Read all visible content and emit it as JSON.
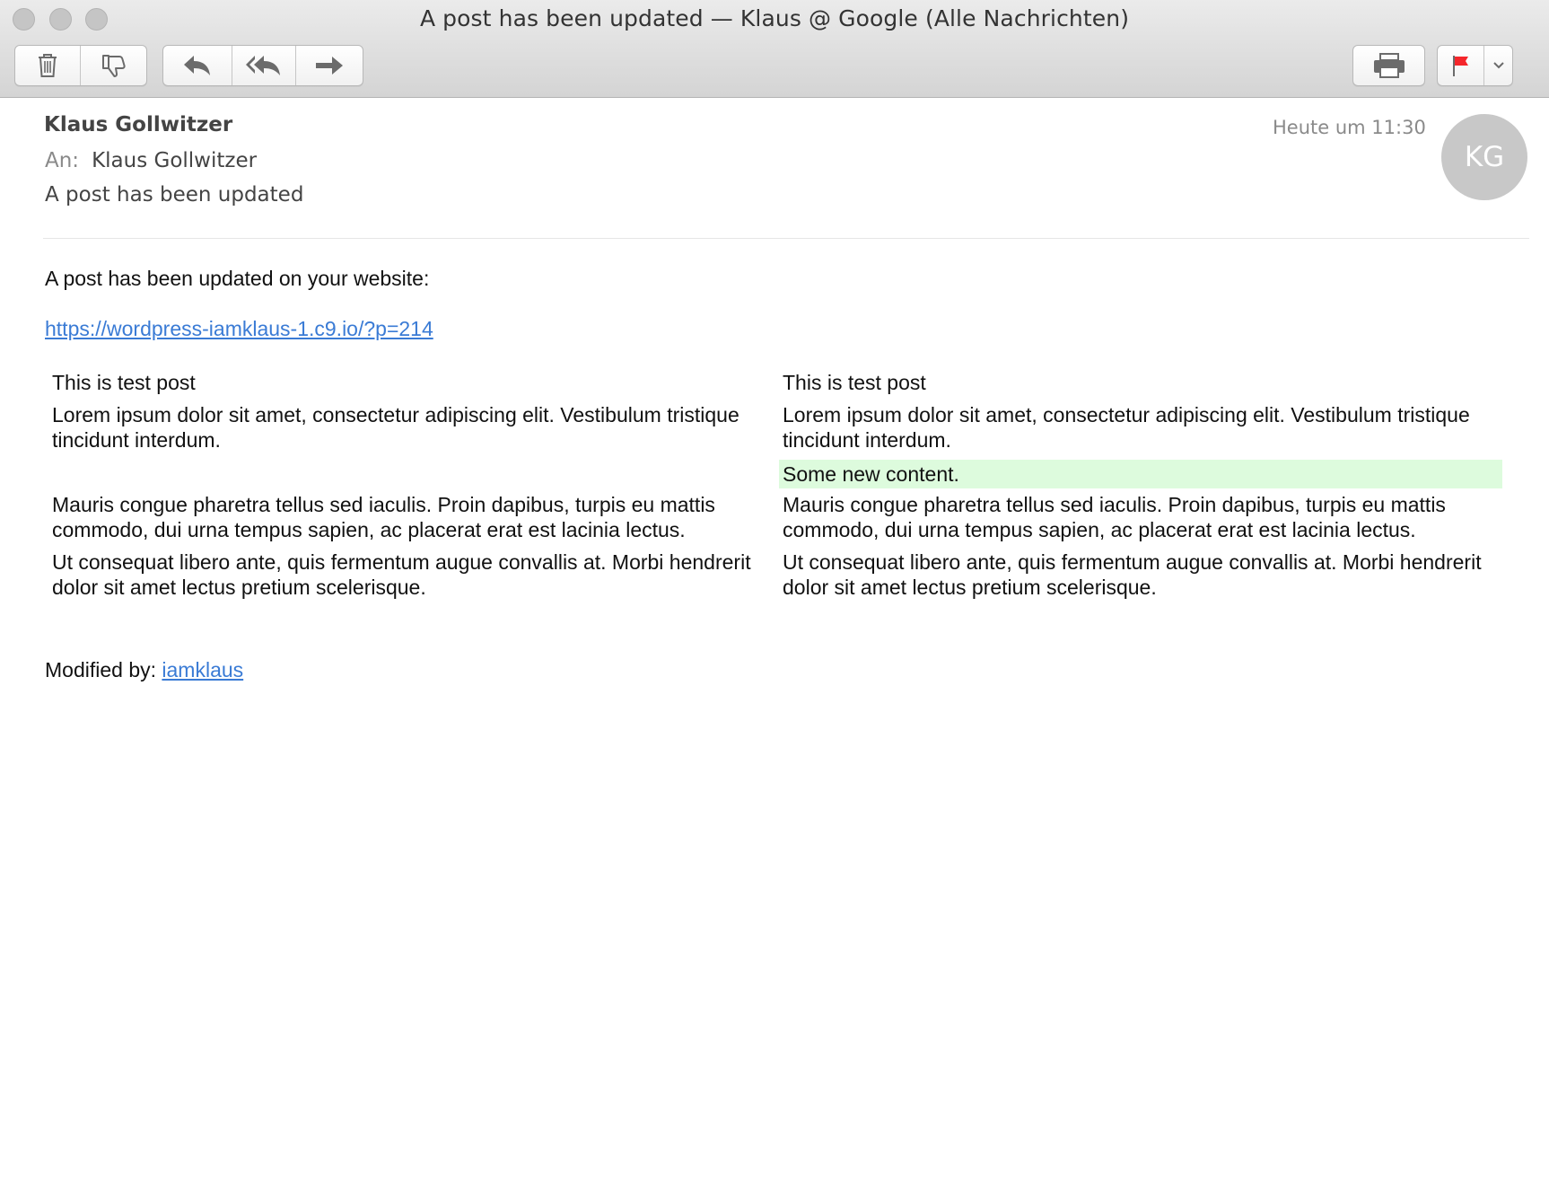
{
  "window": {
    "title": "A post has been updated — Klaus @ Google (Alle Nachrichten)"
  },
  "toolbar": {
    "icons": [
      "trash-icon",
      "thumbs-down-icon",
      "reply-icon",
      "reply-all-icon",
      "forward-icon",
      "printer-icon",
      "flag-icon",
      "chevron-down-icon"
    ],
    "flag_color": "#f5262b"
  },
  "message": {
    "sender": "Klaus Gollwitzer",
    "to_label": "An:",
    "to": "Klaus Gollwitzer",
    "subject": "A post has been updated",
    "date": "Heute um 11:30",
    "avatar_initials": "KG"
  },
  "body": {
    "intro": "A post has been updated on your website:",
    "link": "https://wordpress-iamklaus-1.c9.io/?p=214",
    "old": {
      "title": "This is test post",
      "paragraphs": [
        "Lorem ipsum dolor sit amet, consectetur adipiscing elit. Vestibulum tristique tincidunt interdum.",
        "Mauris congue pharetra tellus sed iaculis. Proin dapibus, turpis eu mattis commodo, dui urna tempus sapien, ac placerat erat est lacinia lectus.",
        "Ut consequat libero ante, quis fermentum augue convallis at. Morbi hendrerit dolor sit amet lectus pretium scelerisque."
      ]
    },
    "new": {
      "title": "This is test post",
      "paragraphs": [
        "Lorem ipsum dolor sit amet, consectetur adipiscing elit. Vestibulum tristique tincidunt interdum.",
        "Some new content.",
        "Mauris congue pharetra tellus sed iaculis. Proin dapibus, turpis eu mattis commodo, dui urna tempus sapien, ac placerat erat est lacinia lectus.",
        "Ut consequat libero ante, quis fermentum augue convallis at. Morbi hendrerit dolor sit amet lectus pretium scelerisque."
      ],
      "added_highlight_color": "#ddfbdd"
    },
    "modified_label": "Modified by:",
    "modified_user": "iamklaus"
  }
}
